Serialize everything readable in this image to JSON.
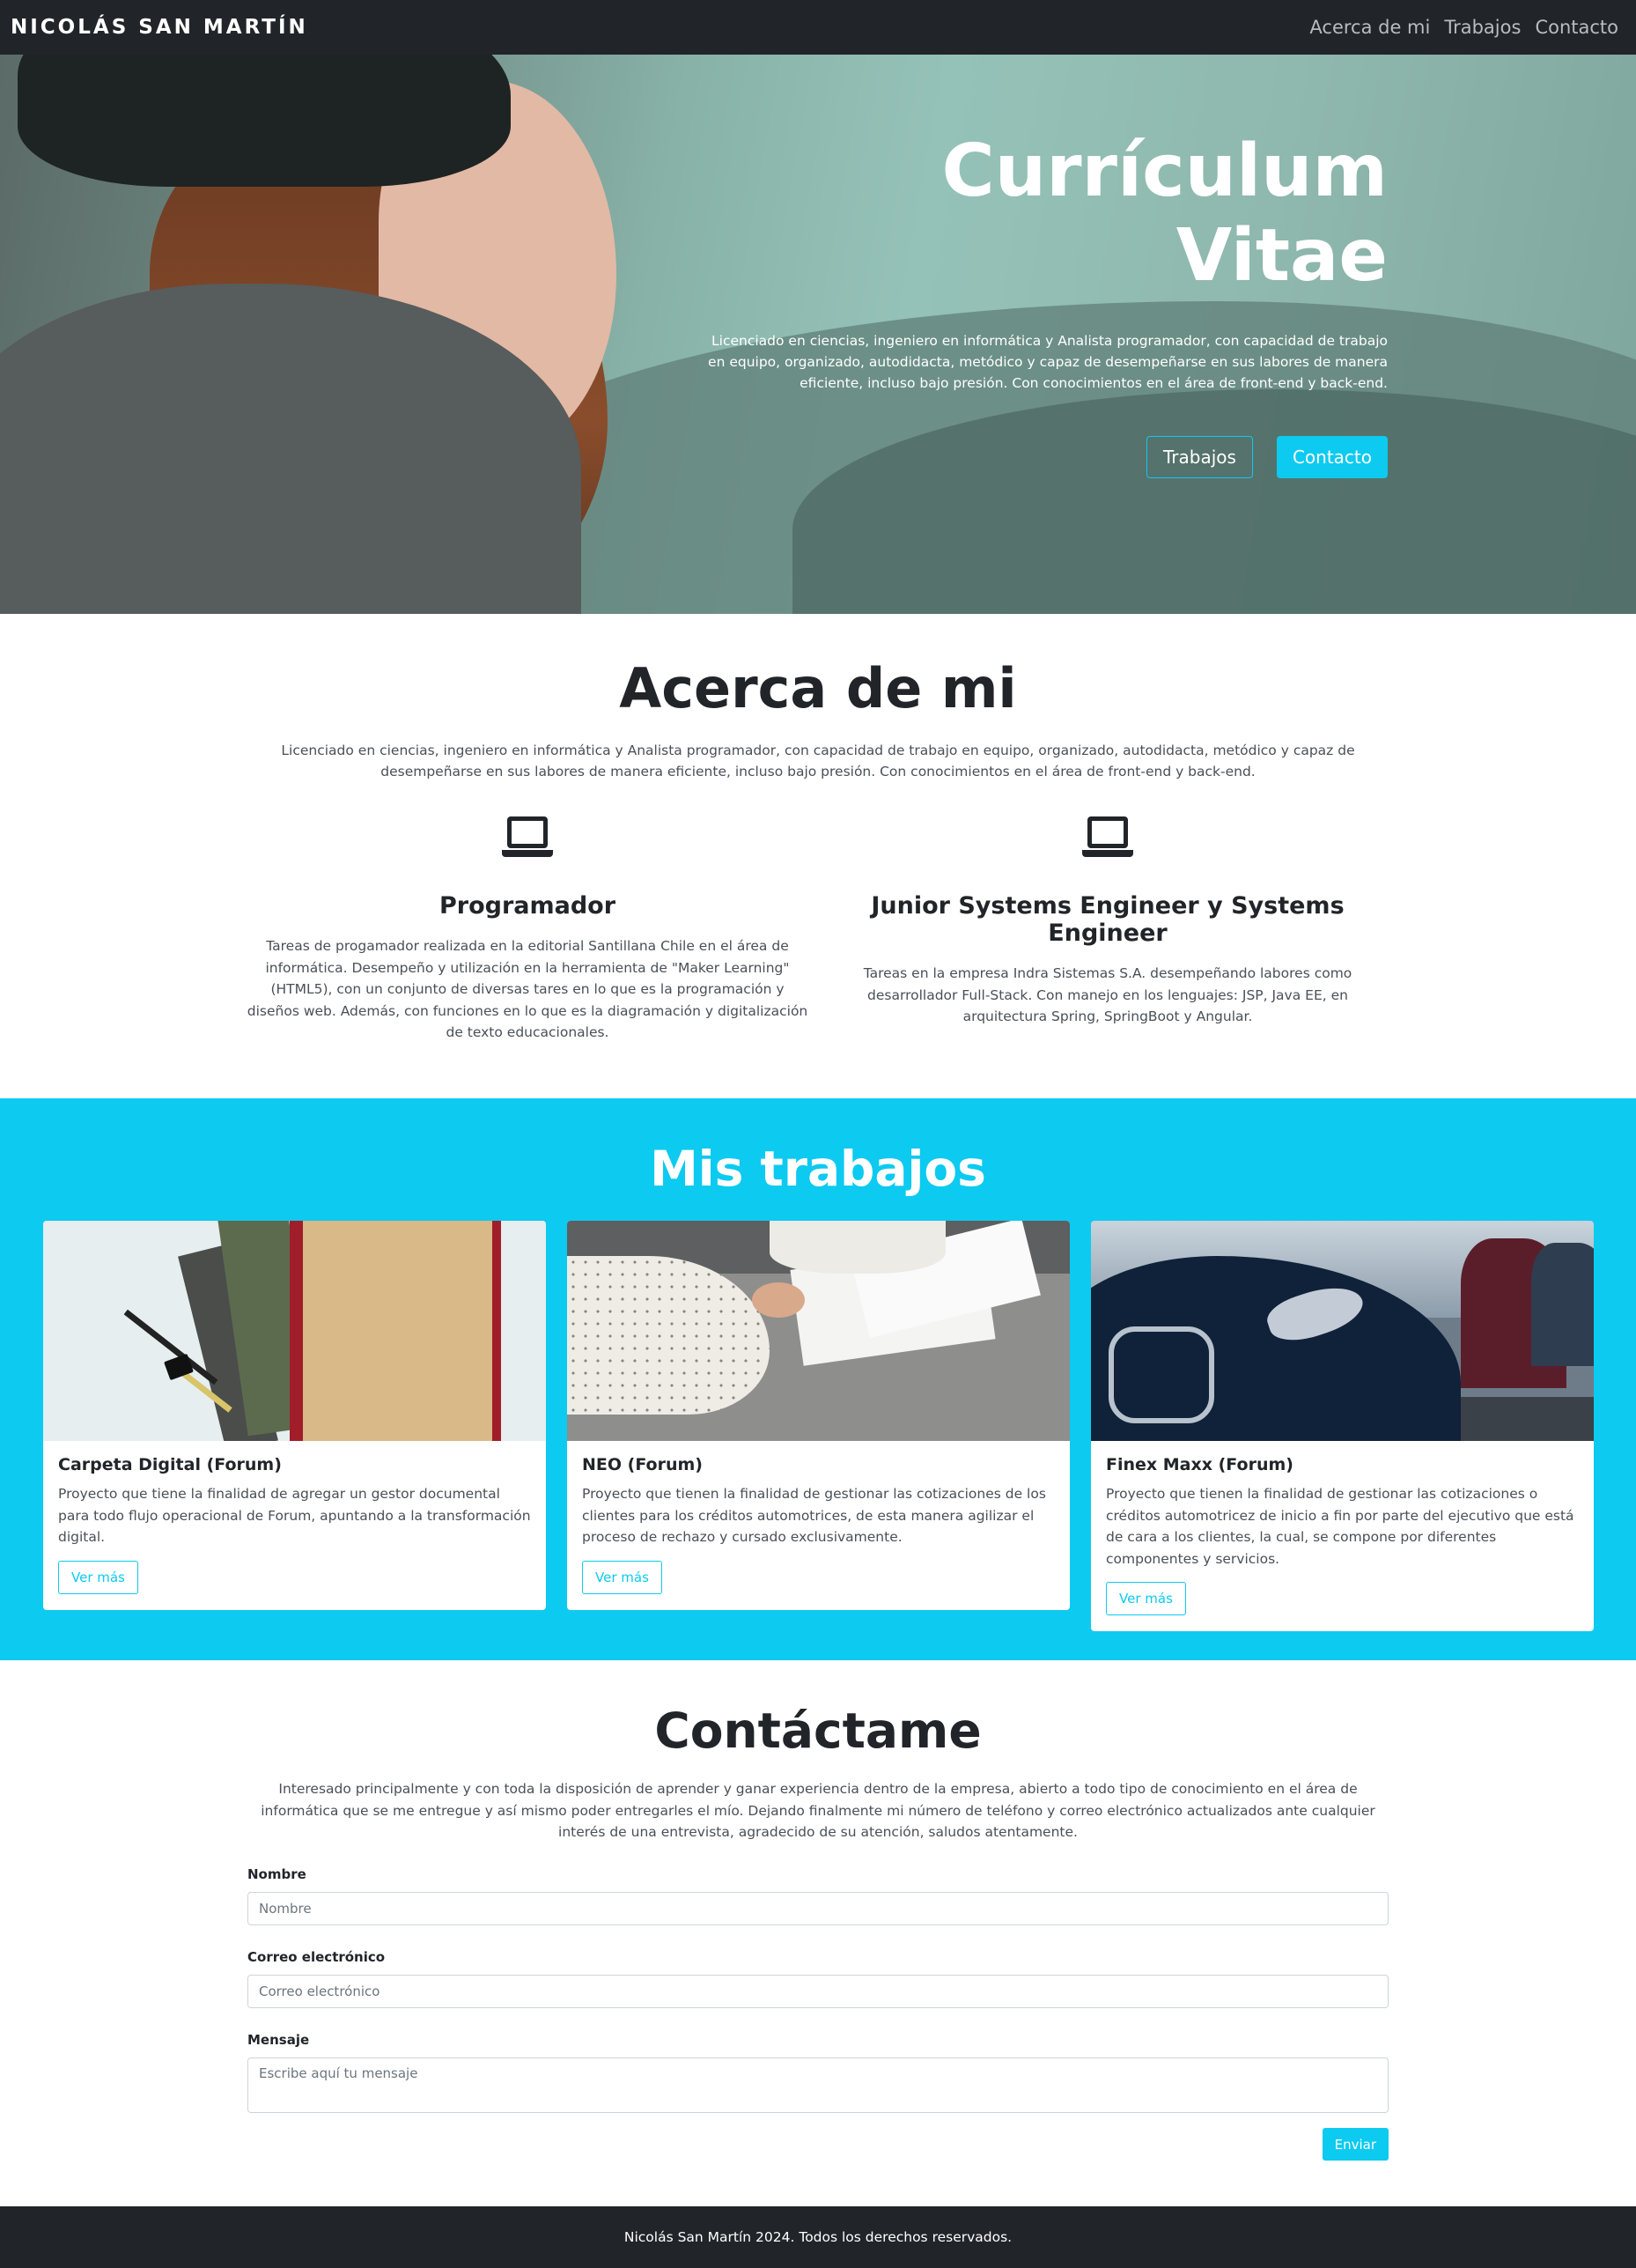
{
  "navbar": {
    "brand": "NICOLÁS SAN MARTÍN",
    "links": [
      "Acerca de mi",
      "Trabajos",
      "Contacto"
    ]
  },
  "hero": {
    "title_line1": "Currículum",
    "title_line2": "Vitae",
    "description": "Licenciado en ciencias, ingeniero en informática y Analista programador, con capacidad de trabajo en equipo, organizado, autodidacta, metódico y capaz de desempeñarse en sus labores de manera eficiente, incluso bajo presión. Con conocimientos en el área de front-end y back-end.",
    "button_works": "Trabajos",
    "button_contact": "Contacto"
  },
  "about": {
    "title": "Acerca de mi",
    "text": "Licenciado en ciencias, ingeniero en informática y Analista programador, con capacidad de trabajo en equipo, organizado, autodidacta, metódico y capaz de desempeñarse en sus labores de manera eficiente, incluso bajo presión. Con conocimientos en el área de front-end y back-end.",
    "columns": [
      {
        "icon": "laptop-icon",
        "title": "Programador",
        "text": "Tareas de progamador realizada en la editorial Santillana Chile en el área de informática. Desempeño y utilización en la herramienta de \"Maker Learning\" (HTML5), con un conjunto de diversas tares en lo que es la programación y diseños web. Además, con funciones en lo que es la diagramación y digitalización de texto educacionales."
      },
      {
        "icon": "laptop-icon",
        "title": "Junior Systems Engineer y Systems Engineer",
        "text": "Tareas en la empresa Indra Sistemas S.A. desempeñando labores como desarrollador Full-Stack. Con manejo en los lenguajes: JSP, Java EE, en arquitectura Spring, SpringBoot y Angular."
      }
    ]
  },
  "works": {
    "title": "Mis trabajos",
    "cards": [
      {
        "title": "Carpeta Digital (Forum)",
        "text": "Proyecto que tiene la finalidad de agregar un gestor documental para todo flujo operacional de Forum, apuntando a la transformación digital.",
        "button": "Ver más"
      },
      {
        "title": "NEO (Forum)",
        "text": "Proyecto que tienen la finalidad de gestionar las cotizaciones de los clientes para los créditos automotrices, de esta manera agilizar el proceso de rechazo y cursado exclusivamente.",
        "button": "Ver más"
      },
      {
        "title": "Finex Maxx (Forum)",
        "text": "Proyecto que tienen la finalidad de gestionar las cotizaciones o créditos automotricez de inicio a fin por parte del ejecutivo que está de cara a los clientes, la cual, se compone por diferentes componentes y servicios.",
        "button": "Ver más"
      }
    ]
  },
  "contact": {
    "title": "Contáctame",
    "text": "Interesado principalmente y con toda la disposición de aprender y ganar experiencia dentro de la empresa, abierto a todo tipo de conocimiento en el área de informática que se me entregue y así mismo poder entregarles el mío. Dejando finalmente mi número de teléfono y correo electrónico actualizados ante cualquier interés de una entrevista, agradecido de su atención, saludos atentamente.",
    "fields": [
      {
        "label": "Nombre",
        "placeholder": "Nombre"
      },
      {
        "label": "Correo electrónico",
        "placeholder": "Correo electrónico"
      },
      {
        "label": "Mensaje",
        "placeholder": "Escribe aquí tu mensaje"
      }
    ],
    "submit": "Enviar"
  },
  "footer": {
    "text": "Nicolás San Martín 2024. Todos los derechos reservados."
  },
  "colors": {
    "accent": "#0dcaf0",
    "dark": "#212529"
  }
}
